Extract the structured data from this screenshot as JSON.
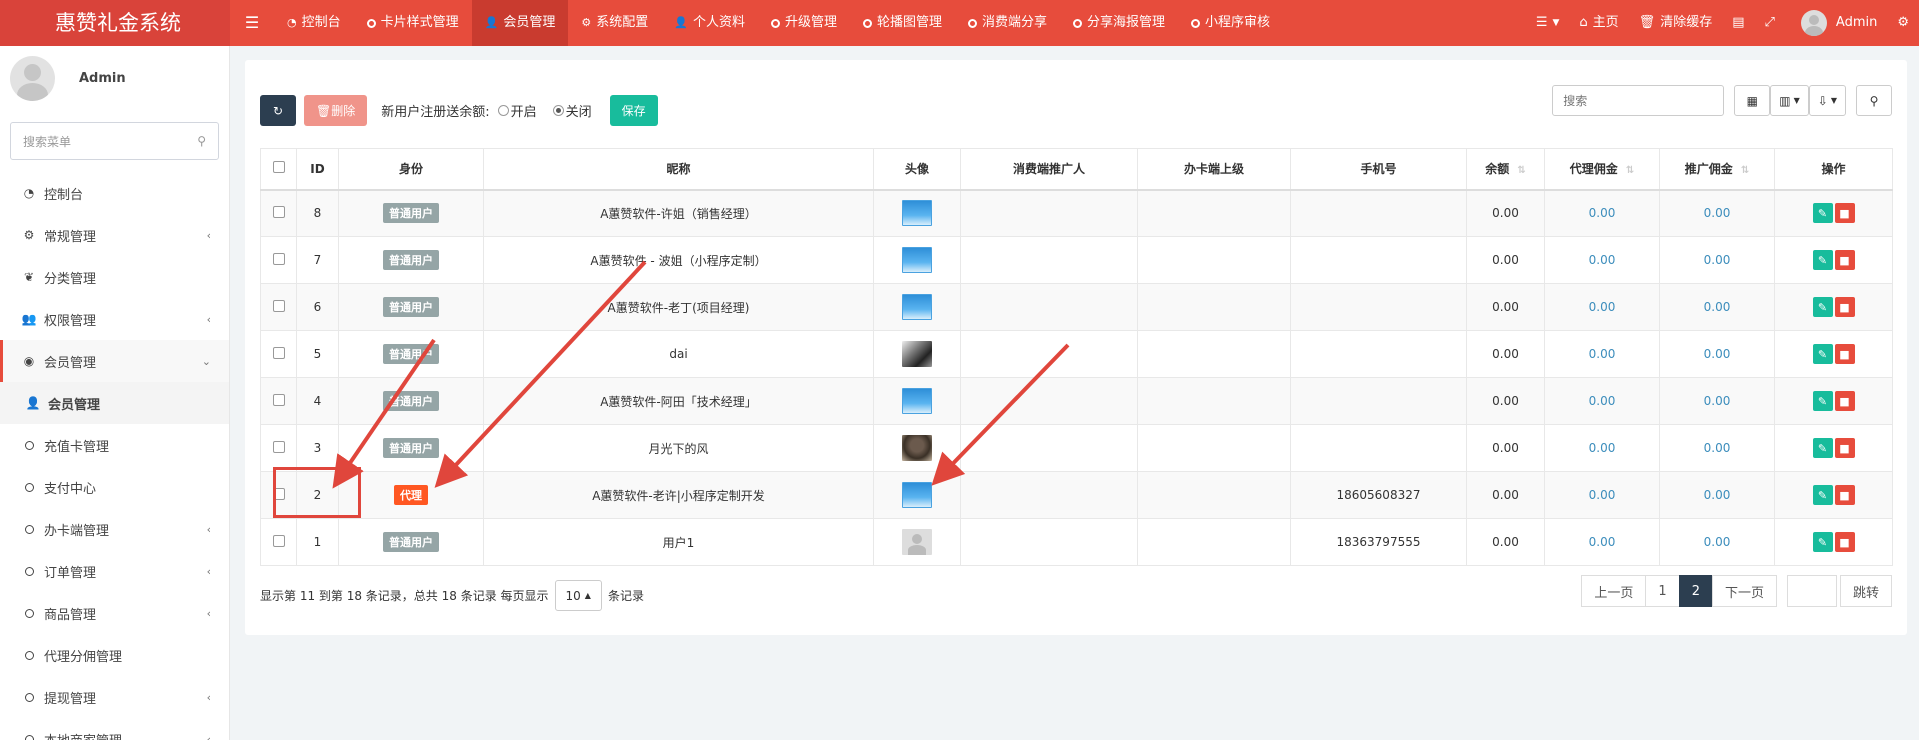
{
  "app": {
    "title": "惠赞礼金系统"
  },
  "topnav": {
    "toggle_icon": "hamburger-icon",
    "items": [
      {
        "label": "控制台",
        "icon": "dashboard-icon"
      },
      {
        "label": "卡片样式管理",
        "icon": "circle-icon"
      },
      {
        "label": "会员管理",
        "icon": "user-icon"
      },
      {
        "label": "系统配置",
        "icon": "gear-icon"
      },
      {
        "label": "个人资料",
        "icon": "user-icon"
      },
      {
        "label": "升级管理",
        "icon": "circle-icon"
      },
      {
        "label": "轮播图管理",
        "icon": "circle-icon"
      },
      {
        "label": "消费端分享",
        "icon": "circle-icon"
      },
      {
        "label": "分享海报管理",
        "icon": "circle-icon"
      },
      {
        "label": "小程序审核",
        "icon": "circle-icon"
      }
    ],
    "right": {
      "home": "主页",
      "clear_cache": "清除缓存",
      "user": "Admin"
    }
  },
  "sidebar": {
    "user_name": "Admin",
    "search_placeholder": "搜索菜单",
    "items": [
      {
        "label": "控制台",
        "icon": "dashboard-icon"
      },
      {
        "label": "常规管理",
        "icon": "cogs-icon"
      },
      {
        "label": "分类管理",
        "icon": "leaf-icon"
      },
      {
        "label": "权限管理",
        "icon": "group-icon"
      },
      {
        "label": "会员管理",
        "icon": "user-circle-icon"
      },
      {
        "label": "会员管理",
        "icon": "user-icon"
      },
      {
        "label": "充值卡管理",
        "icon": "circle-icon"
      },
      {
        "label": "支付中心",
        "icon": "circle-icon"
      },
      {
        "label": "办卡端管理",
        "icon": "circle-icon"
      },
      {
        "label": "订单管理",
        "icon": "circle-icon"
      },
      {
        "label": "商品管理",
        "icon": "circle-icon"
      },
      {
        "label": "代理分佣管理",
        "icon": "circle-icon"
      },
      {
        "label": "提现管理",
        "icon": "circle-icon"
      },
      {
        "label": "本地商家管理",
        "icon": "circle-icon"
      }
    ]
  },
  "toolbar": {
    "delete_label": "删除",
    "register_label": "新用户注册送余额:",
    "radio_on": "开启",
    "radio_off": "关闭",
    "save_label": "保存",
    "search_placeholder": "搜索"
  },
  "table": {
    "headers": [
      "ID",
      "身份",
      "昵称",
      "头像",
      "消费端推广人",
      "办卡端上级",
      "手机号",
      "余额",
      "代理佣金",
      "推广佣金",
      "操作"
    ],
    "rows": [
      {
        "id": "8",
        "role": "普通用户",
        "role_type": "normal",
        "nick": "A蕙赞软件-许姐（销售经理）",
        "avatar": "logo",
        "promoter": "",
        "superior": "",
        "phone": "",
        "balance": "0.00",
        "agent": "0.00",
        "promo": "0.00"
      },
      {
        "id": "7",
        "role": "普通用户",
        "role_type": "normal",
        "nick": "A蕙赞软件 - 波姐（小程序定制）",
        "avatar": "logo",
        "promoter": "",
        "superior": "",
        "phone": "",
        "balance": "0.00",
        "agent": "0.00",
        "promo": "0.00"
      },
      {
        "id": "6",
        "role": "普通用户",
        "role_type": "normal",
        "nick": "A蕙赞软件-老丁(项目经理)",
        "avatar": "logo",
        "promoter": "",
        "superior": "",
        "phone": "",
        "balance": "0.00",
        "agent": "0.00",
        "promo": "0.00"
      },
      {
        "id": "5",
        "role": "普通用户",
        "role_type": "normal",
        "nick": "dai",
        "avatar": "photo1",
        "promoter": "",
        "superior": "",
        "phone": "",
        "balance": "0.00",
        "agent": "0.00",
        "promo": "0.00"
      },
      {
        "id": "4",
        "role": "普通用户",
        "role_type": "normal",
        "nick": "A蕙赞软件-阿田「技术经理」",
        "avatar": "logo",
        "promoter": "",
        "superior": "",
        "phone": "",
        "balance": "0.00",
        "agent": "0.00",
        "promo": "0.00"
      },
      {
        "id": "3",
        "role": "普通用户",
        "role_type": "normal",
        "nick": "月光下的风",
        "avatar": "photo2",
        "promoter": "",
        "superior": "",
        "phone": "",
        "balance": "0.00",
        "agent": "0.00",
        "promo": "0.00"
      },
      {
        "id": "2",
        "role": "代理",
        "role_type": "agent",
        "nick": "A蕙赞软件-老许|小程序定制开发",
        "avatar": "logo",
        "promoter": "",
        "superior": "",
        "phone": "18605608327",
        "balance": "0.00",
        "agent": "0.00",
        "promo": "0.00"
      },
      {
        "id": "1",
        "role": "普通用户",
        "role_type": "normal",
        "nick": "用户1",
        "avatar": "default",
        "promoter": "",
        "superior": "",
        "phone": "18363797555",
        "balance": "0.00",
        "agent": "0.00",
        "promo": "0.00"
      }
    ]
  },
  "footer": {
    "info": "显示第 11 到第 18 条记录，总共 18 条记录 每页显示",
    "page_size": "10",
    "suffix": "条记录"
  },
  "pager": {
    "prev": "上一页",
    "pages": [
      "1",
      "2"
    ],
    "current": "2",
    "next": "下一页",
    "go": "跳转"
  },
  "colors": {
    "primary": "#e74c3c",
    "dark": "#2c3e50",
    "success": "#18bc9c",
    "agent_badge": "#ff5722",
    "normal_badge": "#95a5a6",
    "link": "#3c8dbc"
  }
}
